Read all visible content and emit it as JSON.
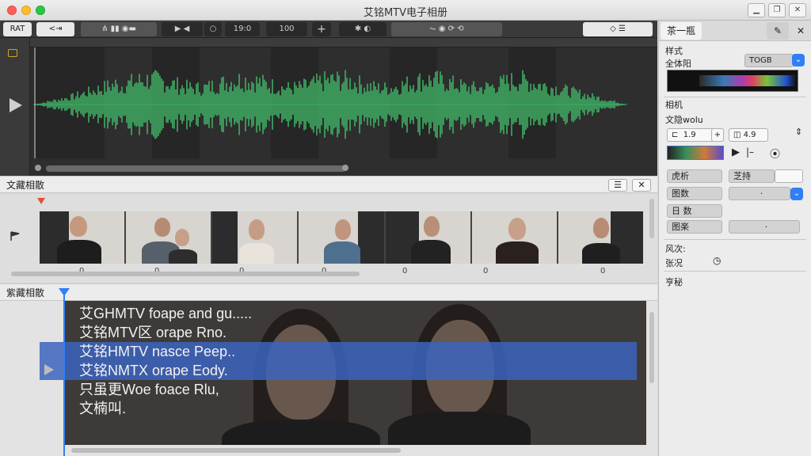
{
  "window": {
    "title": "艾铭MTV电子相册"
  },
  "toolbar": {
    "btn1": "RAT",
    "btn2": "<⇥",
    "btn_time": "19:0",
    "btn_zoom": "100",
    "btn_plus": "+"
  },
  "sections": {
    "thumbs_title": "文藏相散",
    "text_title": "紫藏相散"
  },
  "timeline_ticks": [
    "0",
    "0",
    "0",
    "0",
    "0",
    "0",
    "0"
  ],
  "text_lines": [
    "艾GHMTV foape and gu.....",
    "艾铭MTV区 orape Rno.",
    "艾铭HMTV nasce Peep..",
    "艾铭NMTX orape Eody.",
    "只虽更Woe foace Rlu,",
    "文楠叫."
  ],
  "inspector": {
    "tab_label": "茶一瓶",
    "style_label": "样式",
    "text_style_label": "全体阳",
    "style_value": "TOGB",
    "section_label": "相机",
    "font_label": "文隐wolu",
    "size_value": "1.9",
    "size_value2": "4.9",
    "row1_label": "虎析",
    "row1_value": "芝持",
    "row2_label": "图数",
    "row3_label": "日 数",
    "row4_label": "图楽",
    "extra1": "风次:",
    "extra2": "张况",
    "extra3": "亨秘"
  },
  "colors": {
    "wave": "#3fae63",
    "selection": "#3c64be",
    "playhead": "#2f7ff5"
  }
}
